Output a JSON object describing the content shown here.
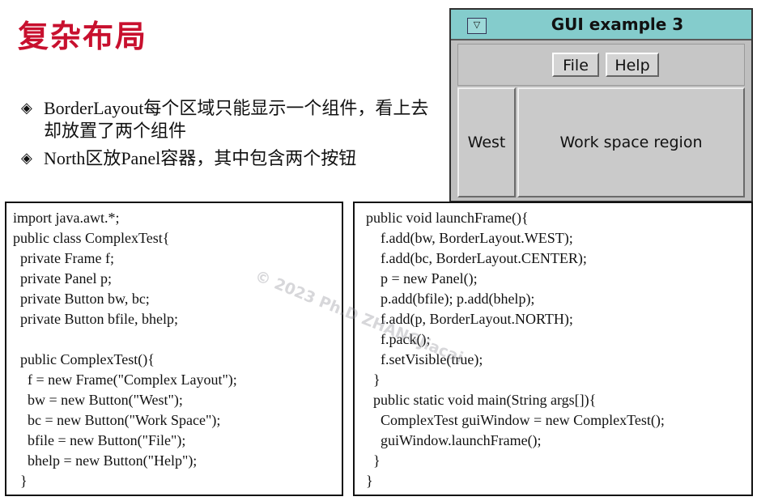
{
  "slide": {
    "title": "复杂布局",
    "bullets": [
      {
        "icon": "diamond-bullet-icon",
        "text": "BorderLayout每个区域只能显示一个组件，看上去却放置了两个组件"
      },
      {
        "icon": "diamond-bullet-icon",
        "text": "North区放Panel容器，其中包含两个按钮"
      }
    ]
  },
  "gui_window": {
    "title": "GUI example 3",
    "system_menu_glyph": "▽",
    "buttons": {
      "file": "File",
      "help": "Help",
      "west": "West",
      "center": "Work space region"
    },
    "titlebar_color": "#84cccc"
  },
  "code": {
    "left": [
      "import java.awt.*;",
      "public class ComplexTest{",
      "  private Frame f;",
      "  private Panel p;",
      "  private Button bw, bc;",
      "  private Button bfile, bhelp;",
      "",
      "  public ComplexTest(){",
      "    f = new Frame(\"Complex Layout\");",
      "    bw = new Button(\"West\");",
      "    bc = new Button(\"Work Space\");",
      "    bfile = new Button(\"File\");",
      "    bhelp = new Button(\"Help\");",
      "  }"
    ],
    "right": [
      "public void launchFrame(){",
      "    f.add(bw, BorderLayout.WEST);",
      "    f.add(bc, BorderLayout.CENTER);",
      "    p = new Panel();",
      "    p.add(bfile); p.add(bhelp);",
      "    f.add(p, BorderLayout.NORTH);",
      "    f.pack();",
      "    f.setVisible(true);",
      "  }",
      "  public static void main(String args[]){",
      "    ComplexTest guiWindow = new ComplexTest();",
      "    guiWindow.launchFrame();",
      "  }",
      "}"
    ]
  },
  "watermark": "© 2023 Ph.D ZHANGJiacai",
  "colors": {
    "title": "#c8102e"
  }
}
